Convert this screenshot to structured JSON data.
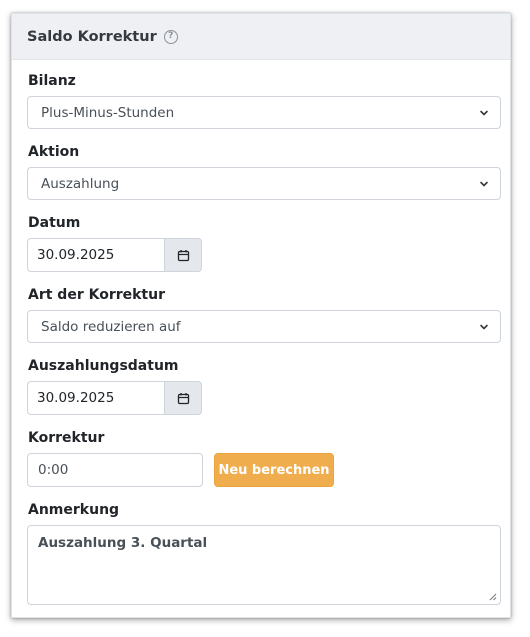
{
  "header": {
    "title": "Saldo Korrektur",
    "help_icon": "question-circle-icon"
  },
  "fields": {
    "bilanz": {
      "label": "Bilanz",
      "value": "Plus-Minus-Stunden"
    },
    "aktion": {
      "label": "Aktion",
      "value": "Auszahlung"
    },
    "datum": {
      "label": "Datum",
      "value": "30.09.2025",
      "icon": "calendar-icon"
    },
    "art": {
      "label": "Art der Korrektur",
      "value": "Saldo reduzieren auf"
    },
    "auszahlungsdatum": {
      "label": "Auszahlungsdatum",
      "value": "30.09.2025",
      "icon": "calendar-icon"
    },
    "korrektur": {
      "label": "Korrektur",
      "value": "0:00",
      "button_label": "Neu berechnen"
    },
    "anmerkung": {
      "label": "Anmerkung",
      "value": "Auszahlung 3. Quartal"
    }
  },
  "colors": {
    "accent_button": "#f0ad4e",
    "header_bg": "#eef0f3"
  }
}
